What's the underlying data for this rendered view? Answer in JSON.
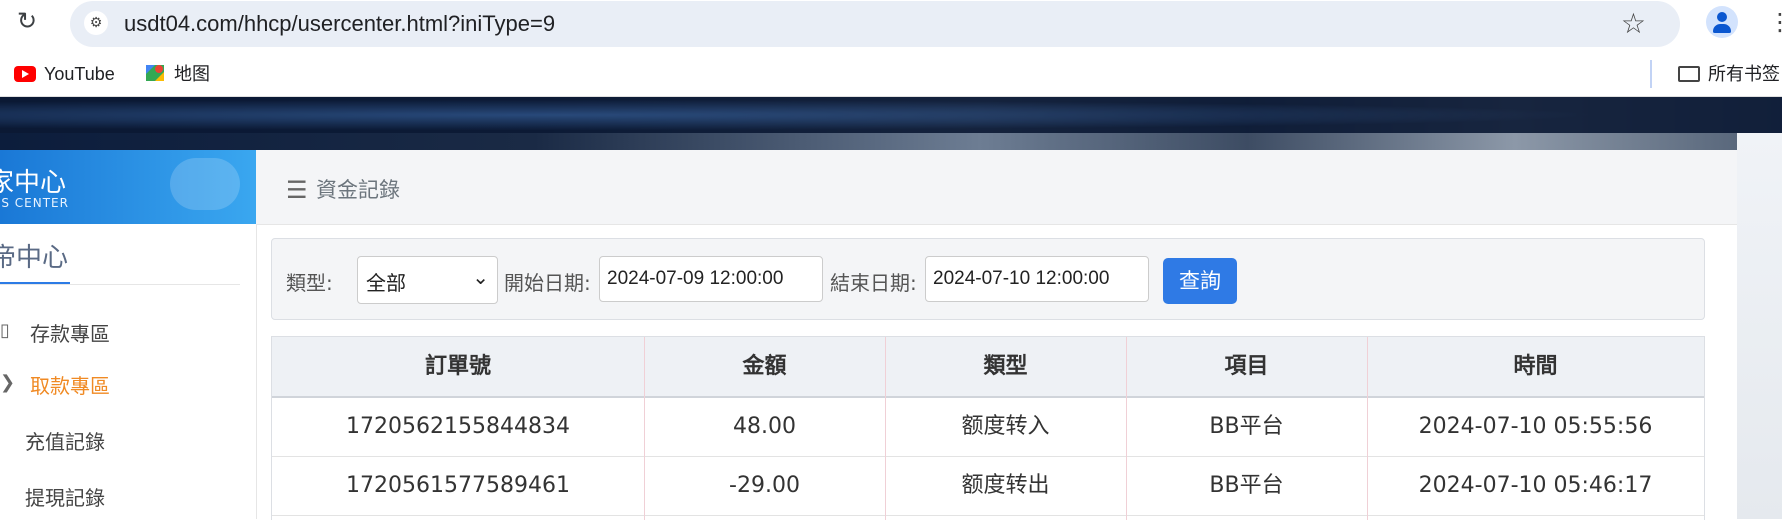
{
  "browser": {
    "url": "usdt04.com/hhcp/usercenter.html?iniType=9",
    "bookmarks": [
      {
        "label": "YouTube",
        "icon": "youtube-icon"
      },
      {
        "label": "地图",
        "icon": "maps-icon"
      }
    ],
    "all_bookmarks_label": "所有书签"
  },
  "sidebar": {
    "banner_cn": "家中心",
    "banner_en": "RS CENTER",
    "title": "帝中心",
    "items": [
      {
        "label": "存款專區",
        "active": false
      },
      {
        "label": "取款專區",
        "active": true
      },
      {
        "label": "充值記錄",
        "active": false
      },
      {
        "label": "提現記錄",
        "active": false
      }
    ]
  },
  "main": {
    "header_title": "資金記錄",
    "filter": {
      "type_label": "類型:",
      "type_value": "全部",
      "start_label": "開始日期:",
      "start_value": "2024-07-09 12:00:00",
      "end_label": "結束日期:",
      "end_value": "2024-07-10 12:00:00",
      "query_label": "查詢"
    },
    "table": {
      "headers": [
        "訂單號",
        "金額",
        "類型",
        "項目",
        "時間"
      ],
      "rows": [
        [
          "1720562155844834",
          "48.00",
          "额度转入",
          "BB平台",
          "2024-07-10 05:55:56"
        ],
        [
          "1720561577589461",
          "-29.00",
          "额度转出",
          "BB平台",
          "2024-07-10 05:46:17"
        ]
      ]
    }
  },
  "colors": {
    "accent": "#2f7ae5",
    "active_item": "#f08a24"
  }
}
